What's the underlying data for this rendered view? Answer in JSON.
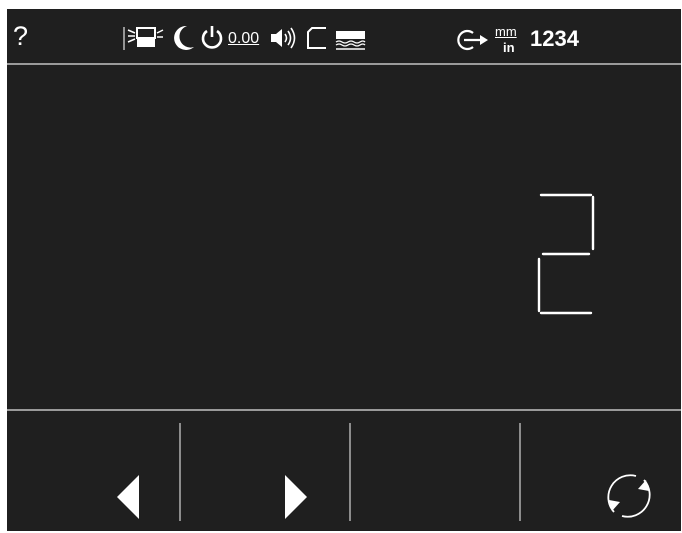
{
  "header": {
    "help_label": "?",
    "offset_text": "0.00",
    "unit_top": "mm",
    "unit_bottom": "in",
    "code_text": "1234"
  },
  "display": {
    "digit": "2",
    "digit_color": "#ffffff"
  },
  "icons": {
    "help": "question-mark-icon",
    "backlight": "backlight-icon",
    "sleep": "moon-icon",
    "power": "power-icon",
    "sound": "speaker-icon",
    "bracket": "corner-bracket-icon",
    "coolant": "coolant-level-icon",
    "login": "login-arrow-icon",
    "prev": "triangle-left-icon",
    "next": "triangle-right-icon",
    "refresh": "refresh-icon"
  },
  "colors": {
    "background": "#1f1f1f",
    "foreground": "#ffffff",
    "divider": "#9a9a9a"
  }
}
